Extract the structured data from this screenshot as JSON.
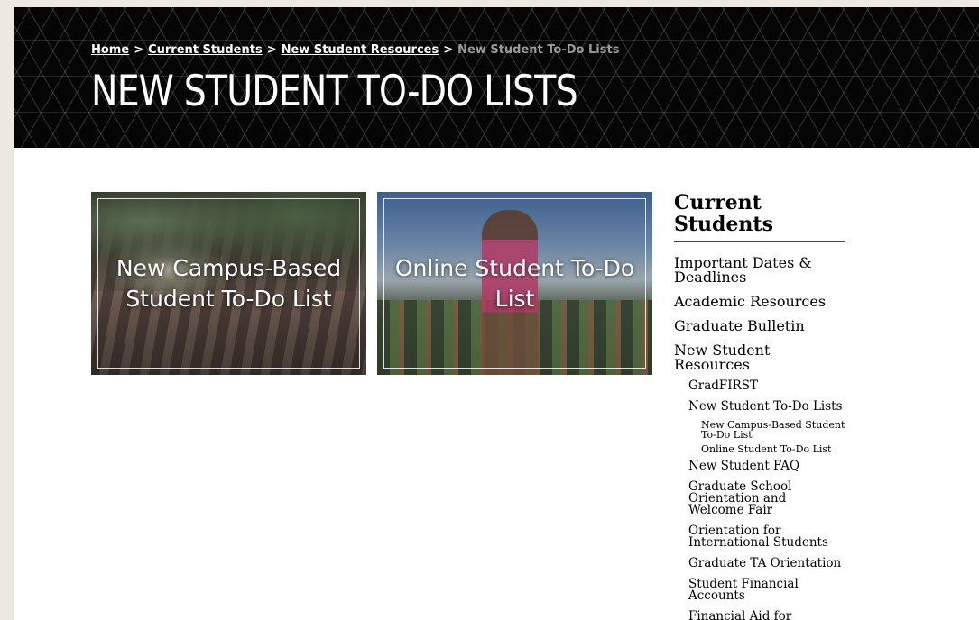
{
  "breadcrumb": {
    "home": "Home",
    "sep1": ">",
    "current_students": "Current Students",
    "sep2": ">",
    "new_student_resources": "New Student Resources",
    "sep3": ">",
    "current": "New Student To-Do Lists"
  },
  "page_title": "NEW STUDENT TO-DO LISTS",
  "cards": [
    {
      "label": "New Campus-Based Student To-Do List"
    },
    {
      "label": "Online Student To-Do List"
    }
  ],
  "sidebar": {
    "title": "Current Students",
    "items": [
      {
        "label": "Important Dates & Deadlines"
      },
      {
        "label": "Academic Resources"
      },
      {
        "label": "Graduate Bulletin"
      },
      {
        "label": "New Student Resources"
      },
      {
        "label": "GradFIRST"
      },
      {
        "label": "New Student To-Do Lists"
      },
      {
        "label": "New Campus-Based Student To-Do List"
      },
      {
        "label": "Online Student To-Do List"
      },
      {
        "label": "New Student FAQ"
      },
      {
        "label": "Graduate School Orientation and Welcome Fair"
      },
      {
        "label": "Orientation for International Students"
      },
      {
        "label": "Graduate TA Orientation"
      },
      {
        "label": "Student Financial Accounts"
      },
      {
        "label": "Financial Aid for Graduate"
      }
    ]
  }
}
